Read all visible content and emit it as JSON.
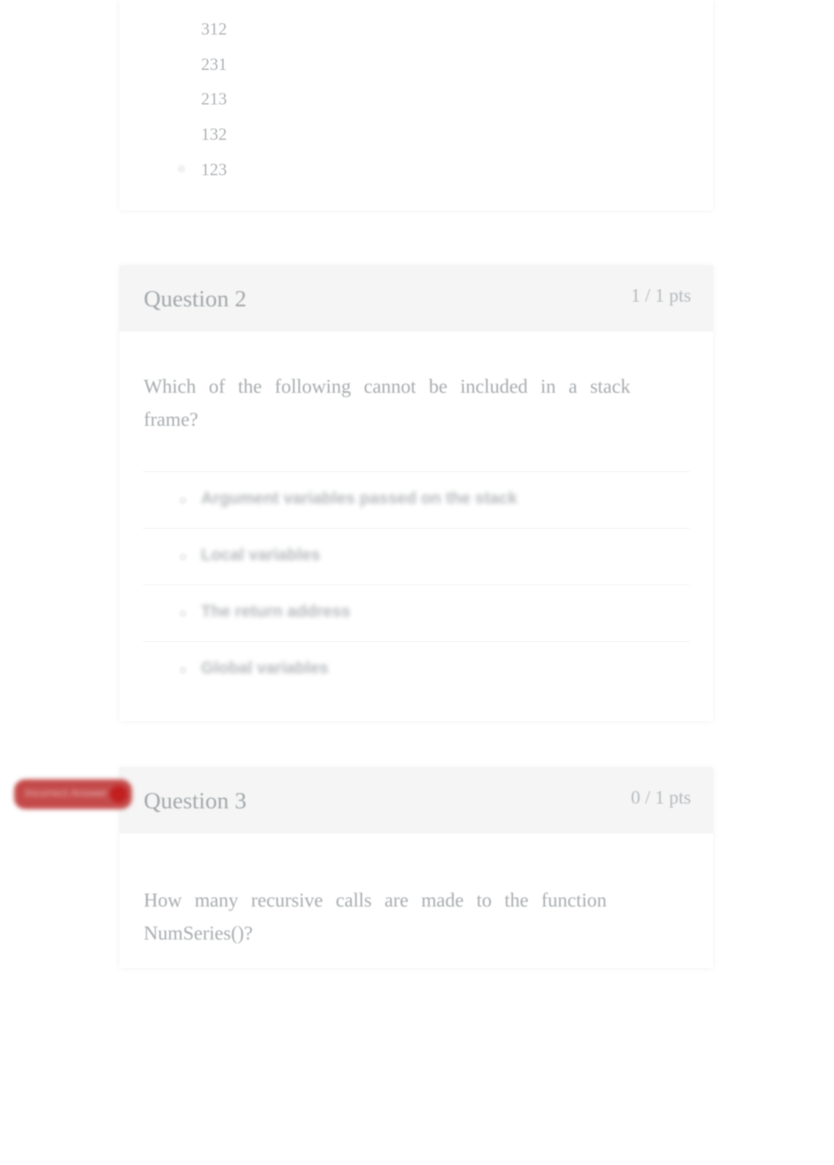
{
  "question1": {
    "options": [
      "312",
      "231",
      "213",
      "132",
      "123"
    ]
  },
  "question2": {
    "title": "Question 2",
    "points": "1 / 1 pts",
    "text": "Which of the following cannot be included in a stack frame?",
    "answers": [
      "Argument variables passed on the stack",
      "Local variables",
      "The return address",
      "Global variables"
    ]
  },
  "question3": {
    "title": "Question 3",
    "points": "0 / 1 pts",
    "text": "How many recursive calls are made to the function NumSeries()?",
    "tag": "Incorrect Answer"
  },
  "colors": {
    "incorrect_tag": "#c44a4a",
    "header_bg": "#f5f5f5"
  }
}
